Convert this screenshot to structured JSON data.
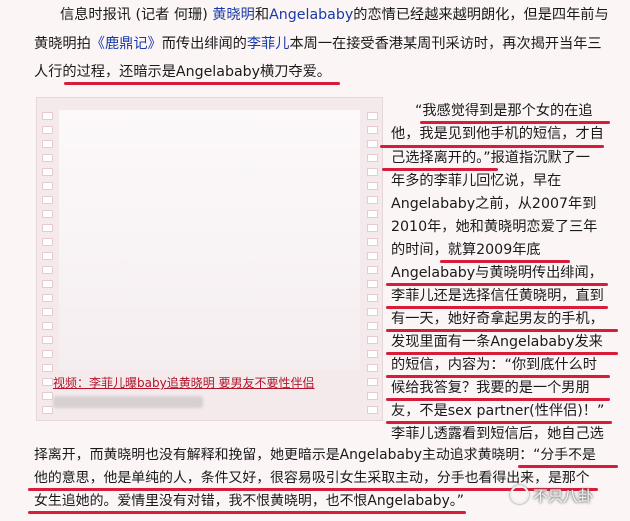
{
  "paragraph1": {
    "line1": {
      "prefix": "信息时报讯 (记者 何珊) ",
      "name1": "黄晓明",
      "mid": "和",
      "name2": "Angelababy",
      "suffix": "的恋情已经越来越明朗化，但是四年前与"
    },
    "line2": {
      "prefix": "黄晓明拍",
      "film": "《鹿鼎记》",
      "mid": "而传出绯闻的",
      "name": "李菲儿",
      "suffix": "本周一在接受香港某周刊采访时，再次揭开当年三"
    },
    "line3": "人行的过程，还暗示是Angelababy横刀夺爱。"
  },
  "video": {
    "caption": "视频：李菲儿曝baby追黄晓明 要男友不要性伴侣"
  },
  "quote_lines": [
    "“我感觉得到是那个女的在追",
    "他，我是见到他手机的短信，才自",
    "己选择离开的。”报道指沉默了一",
    "年多的李菲儿回忆说，早在",
    "Angelababy之前，从2007年到",
    "2010年，她和黄晓明恋爱了三年",
    "的时间，就算2009年底",
    "Angelababy与黄晓明传出绯闻，",
    "李菲儿还是选择信任黄晓明，直到",
    "有一天，她好奇拿起男友的手机，",
    "发现里面有一条Angelababy发来",
    "的短信，内容为：“你到底什么时",
    "候给我答复？我要的是一个男朋",
    "友，不是sex partner(性伴侣)！”",
    "李菲儿透露看到短信后，她自己选"
  ],
  "bottom_lines": [
    "择离开，而黄晓明也没有解释和挽留，她更暗示是Angelababy主动追求黄晓明：“分手不是",
    "他的意思，他是单纯的人，条件又好，很容易吸引女生采取主动，分手也看得出来，是那个",
    "女生追她的。爱情里没有对错，我不恨黄晓明，也不恨Angelababy。”"
  ],
  "watermark": {
    "text": "不只八卦",
    "icon": "chat-bubble-icon"
  },
  "colors": {
    "underline": "#d91c3a",
    "link_blue": "#1a3aa8",
    "caption_red": "#b2132a"
  }
}
